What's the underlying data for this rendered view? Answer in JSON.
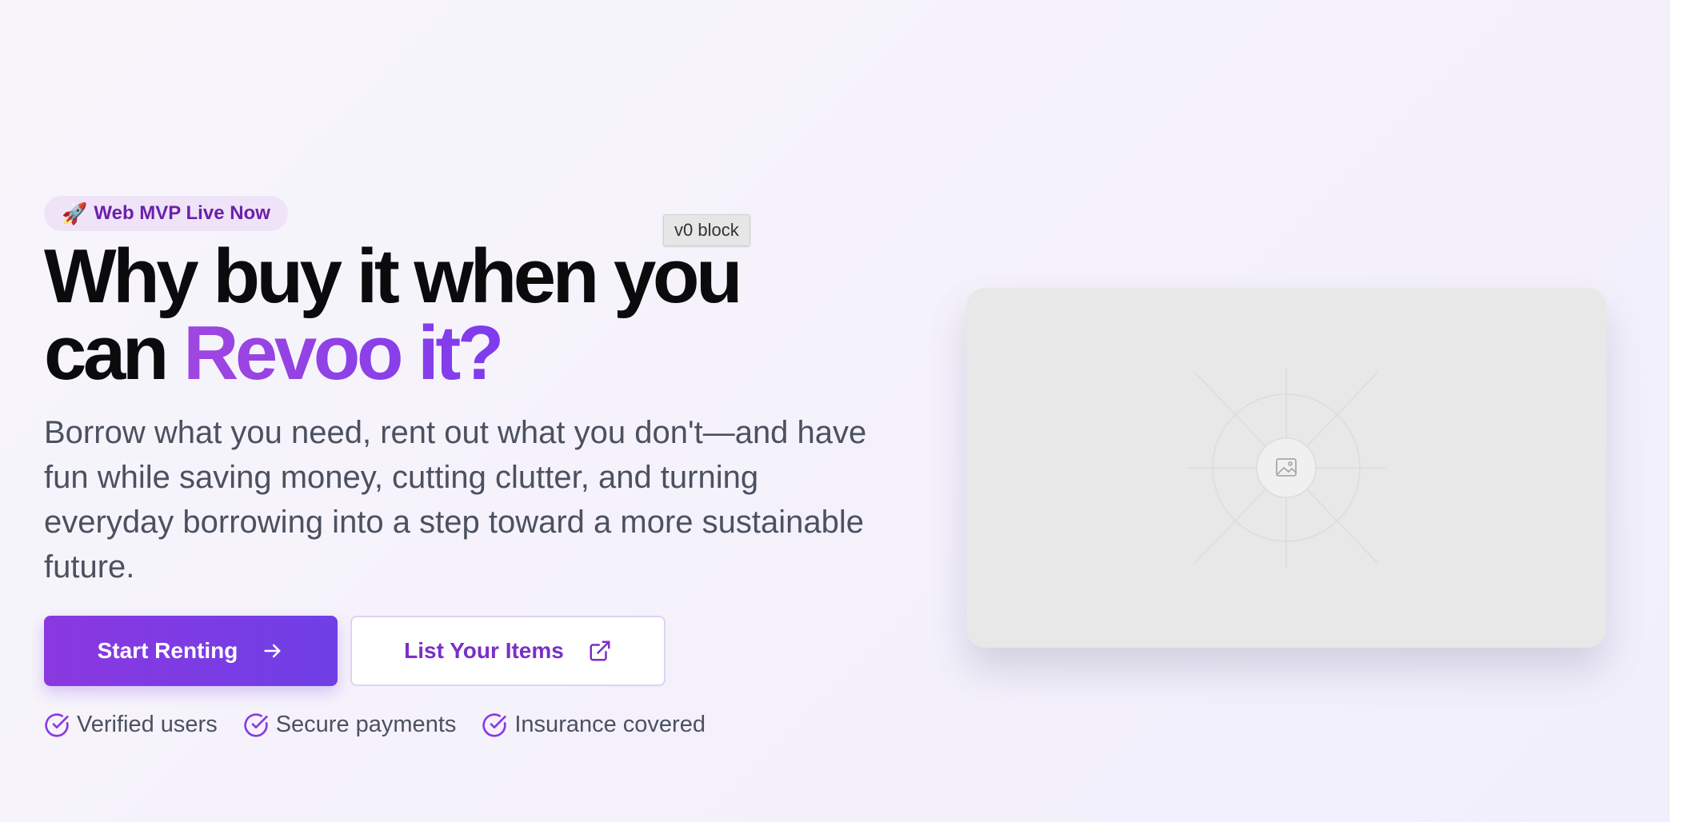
{
  "badge": {
    "emoji": "🚀",
    "label": "Web MVP Live Now"
  },
  "v0_tag": "v0 block",
  "headline": {
    "line1": "Why buy it when you",
    "line2_prefix": "can ",
    "line2_accent": "Revoo it?"
  },
  "subtitle": "Borrow what you need, rent out what you don't—and have fun while saving money, cutting clutter, and turning everyday borrowing into a step toward a more sustainable future.",
  "buttons": {
    "primary_label": "Start Renting",
    "primary_icon": "arrow-right-icon",
    "secondary_label": "List Your Items",
    "secondary_icon": "external-link-icon"
  },
  "trust_items": [
    {
      "label": "Verified users",
      "icon": "check-circle-icon"
    },
    {
      "label": "Secure payments",
      "icon": "check-circle-icon"
    },
    {
      "label": "Insurance covered",
      "icon": "check-circle-icon"
    }
  ],
  "image_placeholder": {
    "icon": "image-icon"
  },
  "colors": {
    "accent": "#7c3aed",
    "accent_start": "#a046e0",
    "badge_bg": "#efe3f8",
    "badge_text": "#6b21a8",
    "heading": "#0b0b0e",
    "body_text": "#4b5160"
  }
}
